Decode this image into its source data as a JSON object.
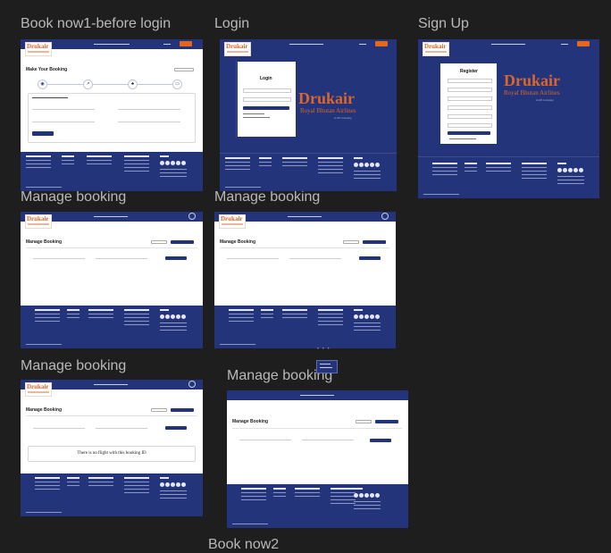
{
  "canvas_labels": {
    "book_now_before_login": "Book now1-before login",
    "login": "Login",
    "sign_up": "Sign Up",
    "manage_booking_1": "Manage booking",
    "manage_booking_2": "Manage booking",
    "manage_booking_3": "Manage booking",
    "manage_booking_4": "Manage booking",
    "bottom_partial_center": "Book now2"
  },
  "brand": {
    "logo_text": "Drukair",
    "big_name": "Drukair",
    "sub_name": "Royal Bhutan Airlines",
    "tagline": "A HP company"
  },
  "colors": {
    "navy": "#24347a",
    "orange": "#e5671e",
    "canvas": "#1e1e1e",
    "label": "#b9b9b9"
  },
  "book_now": {
    "title": "Make Your Booking",
    "step_icons": [
      "user-icon",
      "route-icon",
      "passengers-icon",
      "card-icon"
    ]
  },
  "login_form": {
    "title": "Login"
  },
  "signup_form": {
    "title": "Register"
  },
  "manage": {
    "title": "Manage Booking",
    "no_flight_message": "There is no flight with this booking ID"
  }
}
